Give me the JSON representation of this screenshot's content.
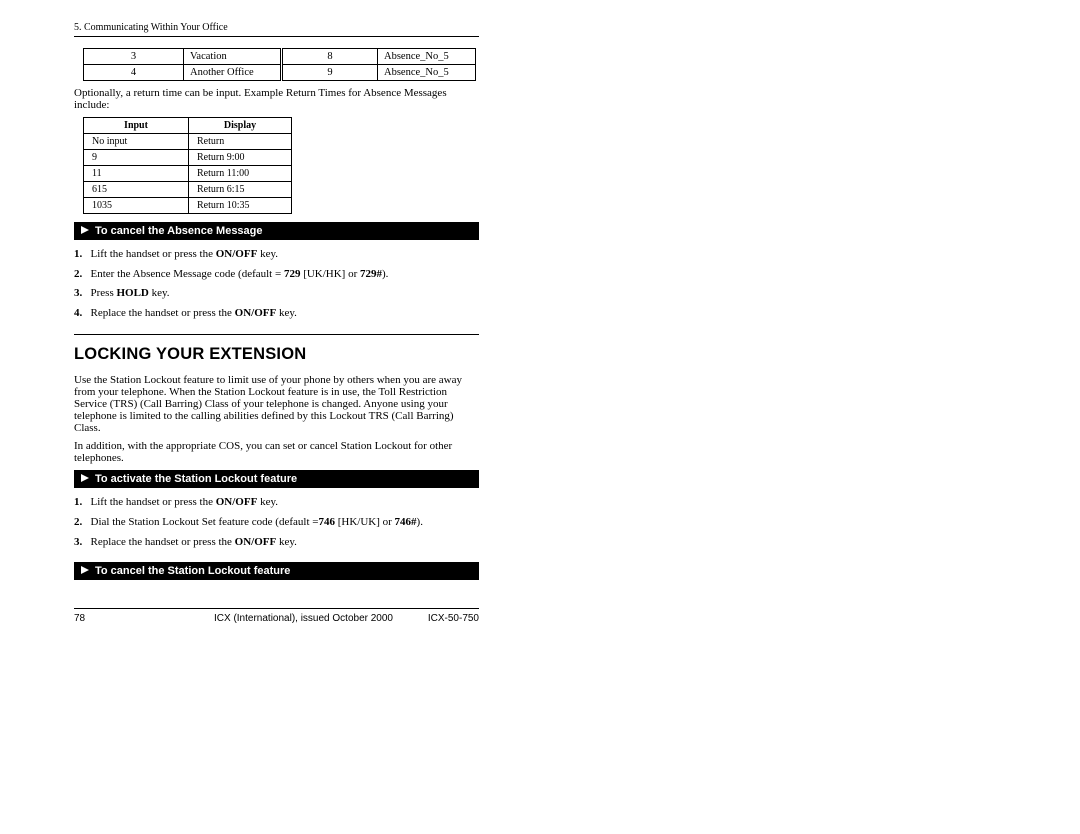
{
  "header": {
    "chapter": "5. Communicating Within Your Office"
  },
  "table1": {
    "rows": [
      {
        "a": "3",
        "b": "Vacation",
        "c": "8",
        "d": "Absence_No_5"
      },
      {
        "a": "4",
        "b": "Another Office",
        "c": "9",
        "d": "Absence_No_5"
      }
    ]
  },
  "para1": "Optionally, a return time can be input. Example Return Times for Absence Messages include:",
  "table2": {
    "head": {
      "a": "Input",
      "b": "Display"
    },
    "rows": [
      {
        "a": "No input",
        "b": "Return"
      },
      {
        "a": "9",
        "b": "Return 9:00"
      },
      {
        "a": "11",
        "b": "Return 11:00"
      },
      {
        "a": "615",
        "b": "Return 6:15"
      },
      {
        "a": "1035",
        "b": "Return 10:35"
      }
    ]
  },
  "bar1": "To cancel the Absence Message",
  "steps1": {
    "s1a": "1.",
    "s1b": "Lift the handset or press the ",
    "s1c": "ON/OFF",
    "s1d": " key.",
    "s2a": "2.",
    "s2b": "Enter the Absence Message code (default = ",
    "s2c": "729",
    "s2d": " [UK/HK] or ",
    "s2e": "729#",
    "s2f": ").",
    "s3a": "3.",
    "s3b": "Press ",
    "s3c": "HOLD",
    "s3d": " key.",
    "s4a": "4.",
    "s4b": "Replace the handset or press the ",
    "s4c": "ON/OFF",
    "s4d": " key."
  },
  "h2": "LOCKING YOUR EXTENSION",
  "para2": "Use the Station Lockout feature to limit use of your phone by others when you are away from your telephone. When the Station Lockout feature is in use, the Toll Restriction Service (TRS) (Call Barring) Class of your telephone is changed. Anyone using your telephone is limited to the calling abilities defined by this Lockout TRS (Call Barring) Class.",
  "para3": "In addition, with the appropriate COS, you can set or cancel Station Lockout for other telephones.",
  "bar2": "To activate the Station Lockout feature",
  "steps2": {
    "s1a": "1.",
    "s1b": "Lift the handset or press the ",
    "s1c": "ON/OFF",
    "s1d": " key.",
    "s2a": "2.",
    "s2b": "Dial the Station Lockout Set feature code (default =",
    "s2c": "746",
    "s2d": " [HK/UK] or ",
    "s2e": "746#",
    "s2f": ").",
    "s3a": "3.",
    "s3b": "Replace the handset or press the ",
    "s3c": "ON/OFF",
    "s3d": " key."
  },
  "bar3": "To cancel the Station Lockout feature",
  "footer": {
    "page": "78",
    "mid": "ICX (International), issued October 2000",
    "doc": "ICX-50-750"
  }
}
